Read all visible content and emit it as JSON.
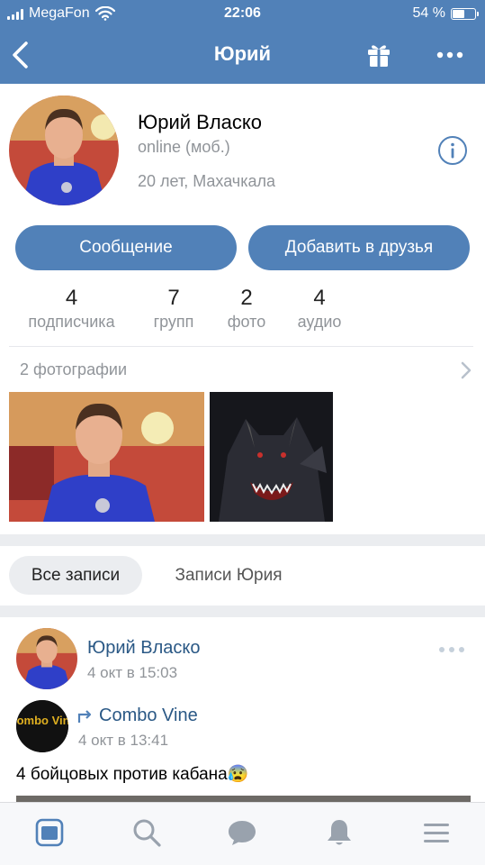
{
  "status_bar": {
    "carrier": "MegaFon",
    "time": "22:06",
    "battery": "54 %",
    "battery_level": 0.54
  },
  "header": {
    "title": "Юрий"
  },
  "profile": {
    "name": "Юрий Власко",
    "status": "online (моб.)",
    "info": "20 лет, Махачкала",
    "message_button": "Сообщение",
    "add_friend_button": "Добавить в друзья",
    "counters": [
      {
        "value": "4",
        "label": "подписчика"
      },
      {
        "value": "7",
        "label": "групп"
      },
      {
        "value": "2",
        "label": "фото"
      },
      {
        "value": "4",
        "label": "аудио"
      }
    ],
    "photos_title": "2 фотографии"
  },
  "tabs": {
    "all_posts": "Все записи",
    "user_posts": "Записи Юрия"
  },
  "post": {
    "author": "Юрий Власко",
    "time": "4 окт в 15:03",
    "repost_author": "Combo Vine",
    "repost_time": "4 окт в 13:41",
    "text": "4 бойцовых против кабана😰",
    "repost_logo_text": "Combo Vine"
  },
  "colors": {
    "brand": "#5181b8",
    "link": "#2a5885",
    "secondary_text": "#909499"
  }
}
